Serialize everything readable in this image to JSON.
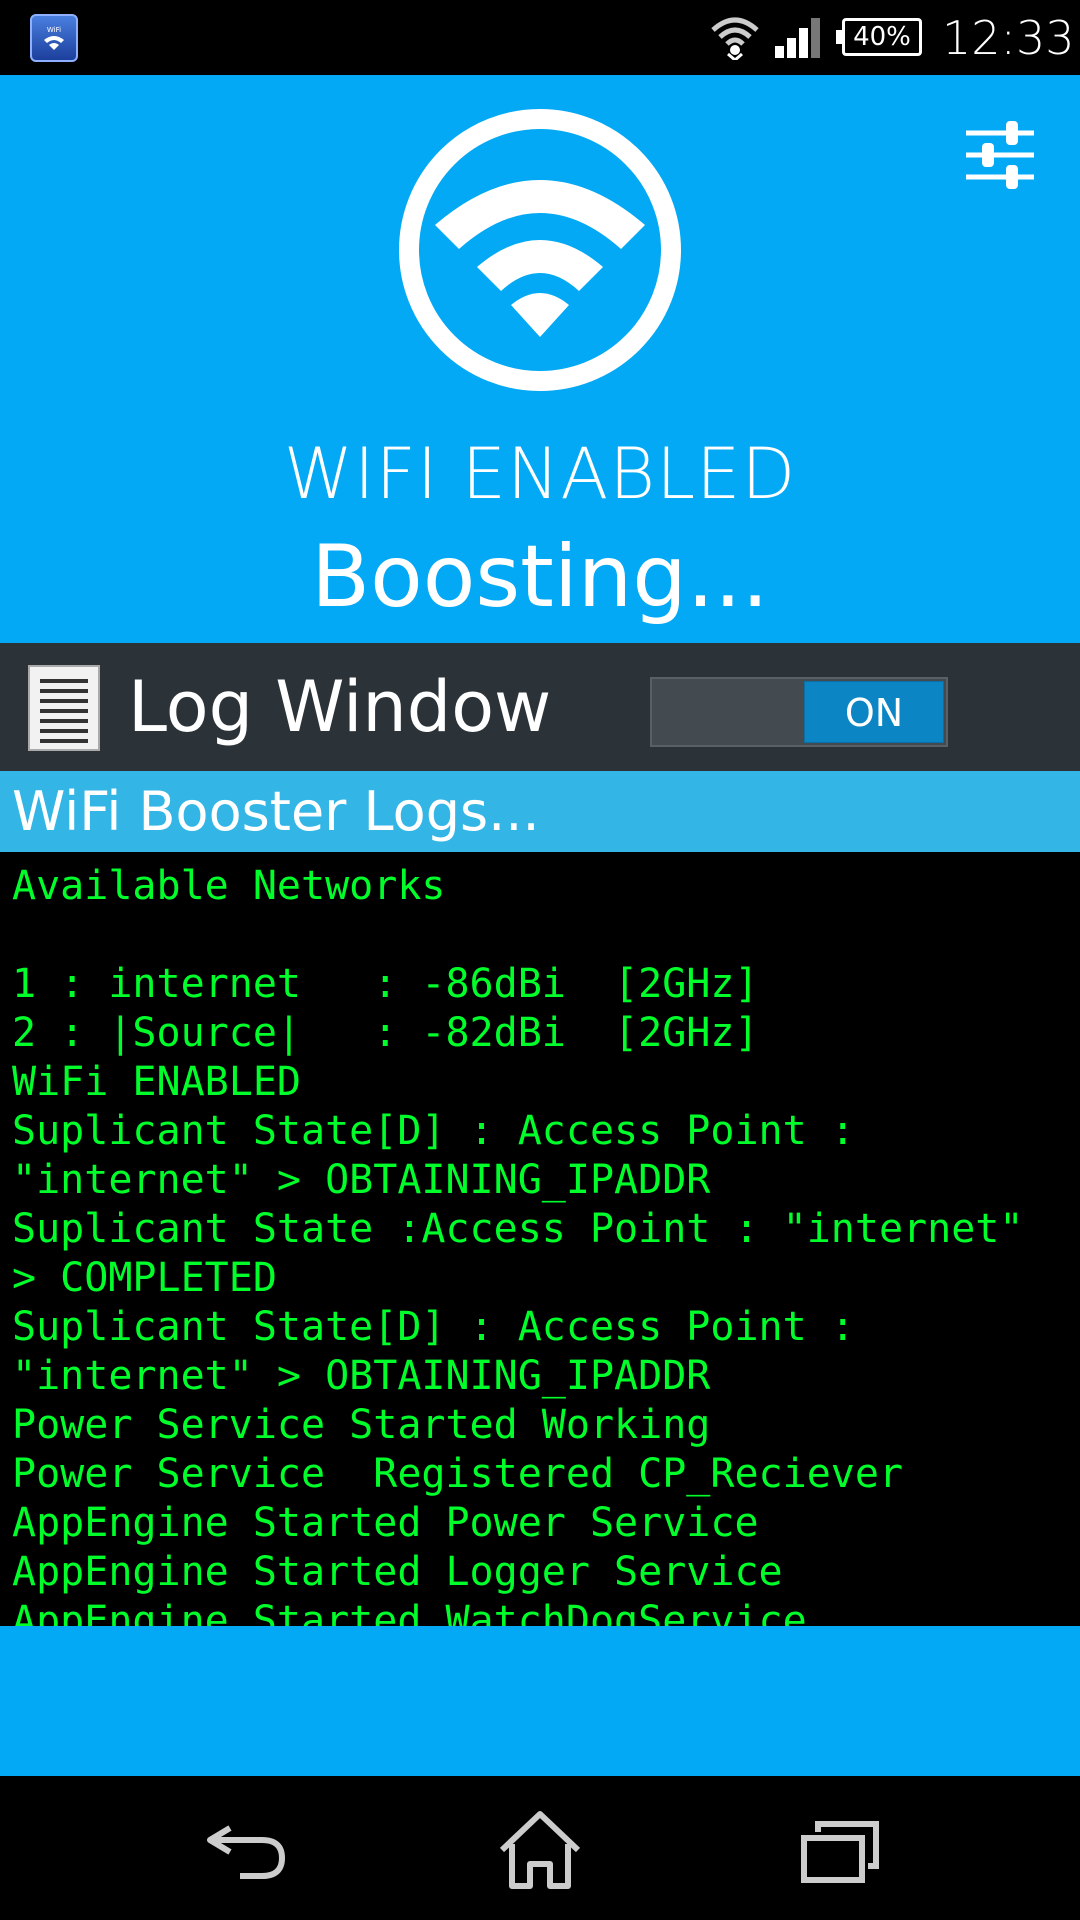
{
  "status_bar": {
    "app_icon_text": "WiFi",
    "battery": "40%",
    "time": "12:33"
  },
  "hero": {
    "status_text": "WIFI ENABLED",
    "boosting_text": "Boosting..."
  },
  "log_window": {
    "title": "Log Window",
    "toggle_label": "ON",
    "toggle_state": "on"
  },
  "logs": {
    "header": "WiFi Booster Logs...",
    "lines": [
      "Available Networks",
      "",
      "1 : internet   : -86dBi  [2GHz]",
      "2 : |Source|   : -82dBi  [2GHz]",
      "WiFi ENABLED",
      "Suplicant State[D] : Access Point :",
      "\"internet\" > OBTAINING_IPADDR",
      "Suplicant State :Access Point : \"internet\"",
      "> COMPLETED",
      "Suplicant State[D] : Access Point :",
      "\"internet\" > OBTAINING_IPADDR",
      "Power Service Started Working",
      "Power Service  Registered CP_Reciever",
      "AppEngine Started Power Service",
      "AppEngine Started Logger Service",
      "AppEngine Started WatchDogService"
    ]
  },
  "icons": {
    "app": "wifi-booster-app-icon",
    "status_wifi": "wifi-signal-icon",
    "status_cell": "cell-signal-icon",
    "settings": "sliders-icon",
    "hero": "wifi-circle-icon",
    "log": "document-list-icon",
    "nav_back": "back-icon",
    "nav_home": "home-icon",
    "nav_recents": "recents-icon"
  },
  "colors": {
    "primary_blue": "#03a9f4",
    "log_header_blue": "#33b5e5",
    "dark_bar": "#2c3338",
    "toggle_on": "#0b85c3",
    "console_text": "#00ff2a"
  }
}
